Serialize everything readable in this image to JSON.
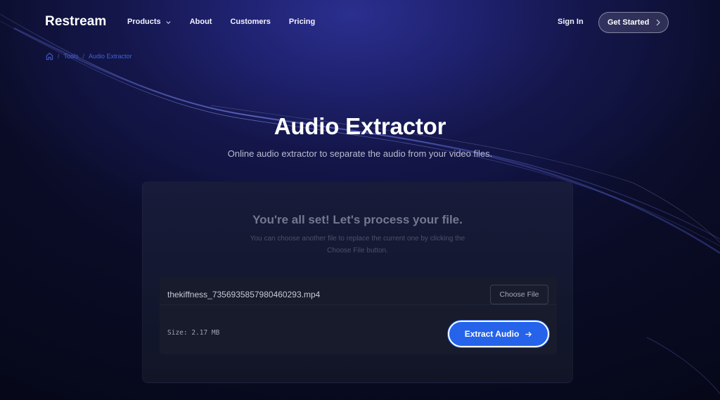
{
  "header": {
    "logo": "Restream",
    "nav": [
      {
        "label": "Products",
        "has_dropdown": true
      },
      {
        "label": "About"
      },
      {
        "label": "Customers"
      },
      {
        "label": "Pricing"
      }
    ],
    "sign_in": "Sign In",
    "get_started": "Get Started"
  },
  "breadcrumb": {
    "home_icon": "home-icon",
    "items": [
      "Tools",
      "Audio Extractor"
    ],
    "separator": "/"
  },
  "hero": {
    "title": "Audio Extractor",
    "subtitle": "Online audio extractor to separate the audio from your video files."
  },
  "card": {
    "title": "You're all set! Let's process your file.",
    "description": "You can choose another file to replace the current one by clicking the Choose File button.",
    "file_name": "thekiffness_7356935857980460293.mp4",
    "choose_file_label": "Choose File",
    "size_text": "Size: 2.17 MB",
    "extract_label": "Extract Audio"
  },
  "colors": {
    "accent": "#2563eb",
    "breadcrumb": "#4262d8",
    "background": "#070916"
  }
}
